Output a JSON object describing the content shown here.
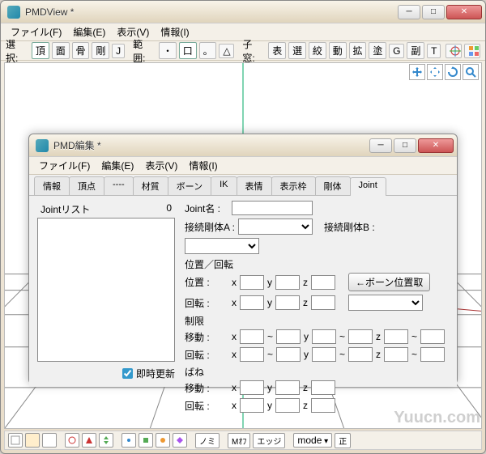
{
  "main": {
    "title": "PMDView *",
    "menu": {
      "file": "ファイル(F)",
      "edit": "編集(E)",
      "view": "表示(V)",
      "info": "情報(I)"
    },
    "toolbar": {
      "select_label": "選択:",
      "sel_items": [
        "頂",
        "面",
        "骨",
        "剛",
        "J"
      ],
      "range_label": "範囲:",
      "range_items": [
        "・",
        "口",
        "。",
        "△"
      ],
      "child_label": "子窓:",
      "child_items": [
        "表",
        "選",
        "絞",
        "動",
        "拡",
        "塗",
        "G",
        "副",
        "T"
      ]
    },
    "bottom": {
      "mode_label": "mode",
      "edge_label": "エッジ",
      "no_label": "ノミ",
      "sei_label": "正",
      "morph_label": "Mｵﾌ"
    },
    "watermark": "Yuucn.com"
  },
  "child": {
    "title": "PMD編集 *",
    "menu": {
      "file": "ファイル(F)",
      "edit": "編集(E)",
      "view": "表示(V)",
      "info": "情報(I)"
    },
    "tabs": [
      "情報",
      "頂点",
      "----",
      "材質",
      "ボーン",
      "IK",
      "表情",
      "表示枠",
      "剛体",
      "Joint"
    ],
    "active_tab": "Joint",
    "list_header": "Jointリスト",
    "list_count": "0",
    "update_label": "即時更新",
    "form": {
      "name_label": "Joint名 :",
      "conn_a": "接続剛体A :",
      "conn_b": "接続剛体B :",
      "posrot_title": "位置／回転",
      "pos_label": "位置 :",
      "rot_label": "回転 :",
      "bone_btn": "←ボーン位置取",
      "limit_title": "制限",
      "move_label": "移動 :",
      "spring_title": "ばね",
      "x": "x",
      "y": "y",
      "z": "z",
      "tilde": "~"
    }
  }
}
